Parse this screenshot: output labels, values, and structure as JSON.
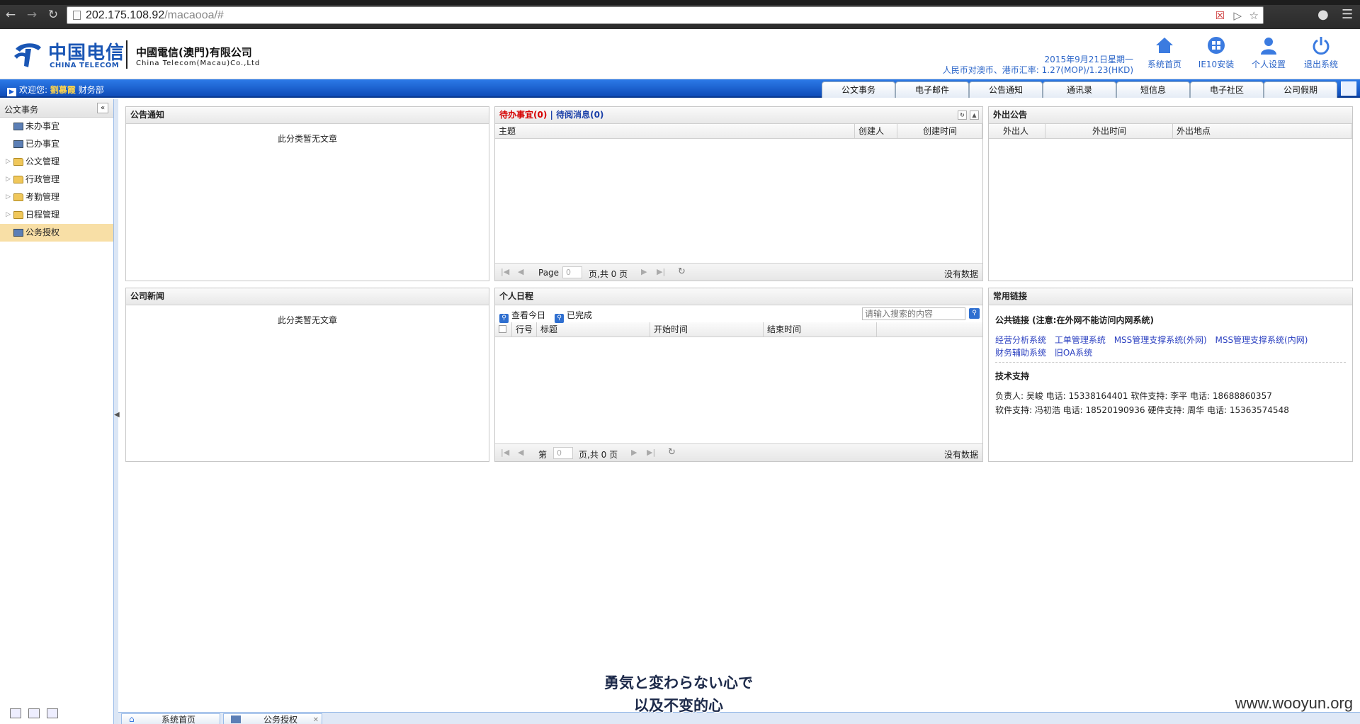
{
  "browser": {
    "url_host": "202.175.108.92",
    "url_path": "/macaooa/#"
  },
  "header": {
    "logo_cn": "中国电信",
    "logo_en": "CHINA TELECOM",
    "company_cn": "中國電信(澳門)有限公司",
    "company_en": "China Telecom(Macau)Co.,Ltd",
    "date": "2015年9月21日星期一",
    "rate": "人民币对澳币、港币汇率: 1.27(MOP)/1.23(HKD)",
    "nav": [
      {
        "label": "系统首页",
        "icon": "home-icon"
      },
      {
        "label": "IE10安装",
        "icon": "ie-install-icon"
      },
      {
        "label": "个人设置",
        "icon": "user-icon"
      },
      {
        "label": "退出系统",
        "icon": "power-icon"
      }
    ]
  },
  "bluebar": {
    "welcome_prefix": "欢迎您:",
    "user_name": "劉慕霞",
    "department": "财务部",
    "tabs": [
      "公文事务",
      "电子邮件",
      "公告通知",
      "通讯录",
      "短信息",
      "电子社区",
      "公司假期"
    ]
  },
  "sidebar": {
    "title": "公文事务",
    "items": [
      {
        "label": "未办事宜",
        "type": "doc"
      },
      {
        "label": "已办事宜",
        "type": "doc"
      },
      {
        "label": "公文管理",
        "type": "folder"
      },
      {
        "label": "行政管理",
        "type": "folder"
      },
      {
        "label": "考勤管理",
        "type": "folder"
      },
      {
        "label": "日程管理",
        "type": "folder"
      },
      {
        "label": "公务授权",
        "type": "doc"
      }
    ]
  },
  "panels": {
    "announce": {
      "title": "公告通知",
      "empty": "此分类暂无文章"
    },
    "news": {
      "title": "公司新闻",
      "empty": "此分类暂无文章"
    },
    "todo": {
      "tab_pending": "待办事宜(0)",
      "separator": "|",
      "tab_read": "待阅消息(0)",
      "columns": [
        "主题",
        "创建人",
        "创建时间"
      ],
      "pager_page": "Page",
      "pager_value": "0",
      "pager_total": "页,共 0 页",
      "nodata": "没有数据"
    },
    "outing": {
      "title": "外出公告",
      "columns": [
        "外出人",
        "外出时间",
        "外出地点"
      ]
    },
    "schedule": {
      "title": "个人日程",
      "btn_today": "查看今日",
      "btn_done": "已完成",
      "search_placeholder": "请输入搜索的内容",
      "columns": [
        "行号",
        "标题",
        "开始时间",
        "结束时间"
      ],
      "pager_prefix": "第",
      "pager_value": "0",
      "pager_total": "页,共 0 页",
      "nodata": "没有数据"
    },
    "links": {
      "title": "常用链接",
      "public_title": "公共链接 (注意:在外网不能访问内网系统)",
      "links_row1": [
        "经营分析系统",
        "工单管理系统",
        "MSS管理支撑系统(外网)",
        "MSS管理支撑系统(内网)"
      ],
      "links_row2": [
        "财务辅助系统",
        "旧OA系统"
      ],
      "support_title": "技术支持",
      "contact1": "负责人: 吴峻   电话: 15338164401  软件支持: 李平   电话: 18688860357",
      "contact2": "软件支持: 冯初浩   电话: 18520190936  硬件支持: 周华   电话: 15363574548"
    }
  },
  "taskbar": {
    "tabs": [
      "系统首页",
      "公务授权"
    ]
  },
  "overlay": {
    "subtitle_line1": "勇気と変わらない心で",
    "subtitle_line2": "以及不变的心",
    "watermark": "www.wooyun.org"
  }
}
